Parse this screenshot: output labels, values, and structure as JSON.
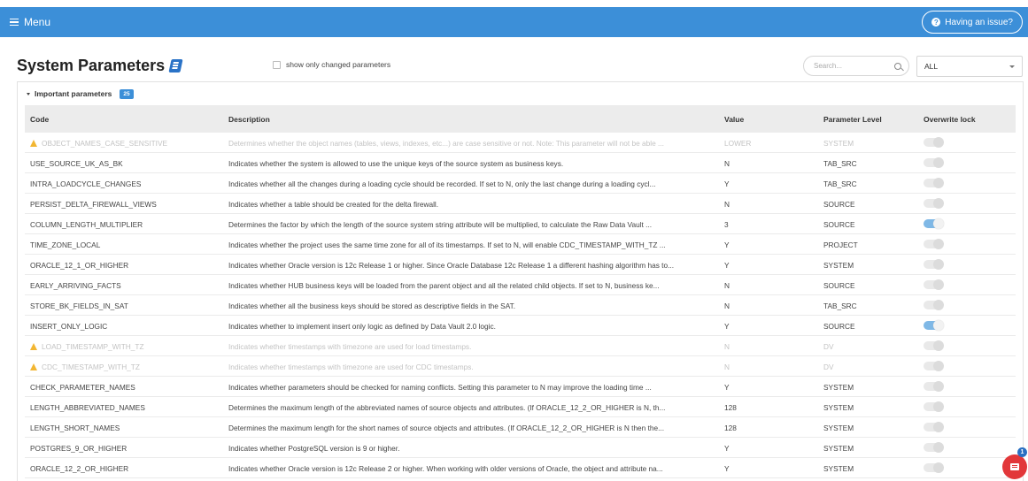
{
  "topbar": {
    "menu_label": "Menu",
    "issue_label": "Having an issue?"
  },
  "page": {
    "title": "System Parameters",
    "show_changed_label": "show only changed parameters",
    "search_placeholder": "Search...",
    "level_selected": "ALL"
  },
  "section": {
    "title": "Important parameters",
    "count": "25"
  },
  "table": {
    "headers": {
      "code": "Code",
      "description": "Description",
      "value": "Value",
      "level": "Parameter Level",
      "lock": "Overwrite lock"
    },
    "rows": [
      {
        "code": "OBJECT_NAMES_CASE_SENSITIVE",
        "description": "Determines whether the object names (tables, views, indexes, etc...) are case sensitive or not. Note: This parameter will not be able ...",
        "value": "LOWER",
        "level": "SYSTEM",
        "lock": false,
        "dim": true,
        "warn": true
      },
      {
        "code": "USE_SOURCE_UK_AS_BK",
        "description": "Indicates whether the system is allowed to use the unique keys of the source system as business keys.",
        "value": "N",
        "level": "TAB_SRC",
        "lock": false,
        "dim": false,
        "warn": false
      },
      {
        "code": "INTRA_LOADCYCLE_CHANGES",
        "description": "Indicates whether all the changes during a loading cycle should be recorded. If set to N, only the last change during a loading cycl...",
        "value": "Y",
        "level": "TAB_SRC",
        "lock": false,
        "dim": false,
        "warn": false
      },
      {
        "code": "PERSIST_DELTA_FIREWALL_VIEWS",
        "description": "Indicates whether a table should be created for the delta firewall.",
        "value": "N",
        "level": "SOURCE",
        "lock": false,
        "dim": false,
        "warn": false
      },
      {
        "code": "COLUMN_LENGTH_MULTIPLIER",
        "description": "Determines the factor by which the length of the source system string attribute will be multiplied, to calculate the Raw Data Vault ...",
        "value": "3",
        "level": "SOURCE",
        "lock": true,
        "dim": false,
        "warn": false
      },
      {
        "code": "TIME_ZONE_LOCAL",
        "description": "Indicates whether the project uses the same time zone for all of its timestamps. If set to N, will enable CDC_TIMESTAMP_WITH_TZ ...",
        "value": "Y",
        "level": "PROJECT",
        "lock": false,
        "dim": false,
        "warn": false
      },
      {
        "code": "ORACLE_12_1_OR_HIGHER",
        "description": "Indicates whether Oracle version is 12c Release 1 or higher. Since Oracle Database 12c Release 1 a different hashing algorithm has to...",
        "value": "Y",
        "level": "SYSTEM",
        "lock": false,
        "dim": false,
        "warn": false
      },
      {
        "code": "EARLY_ARRIVING_FACTS",
        "description": "Indicates whether HUB business keys will be loaded from the parent object and all the related child objects. If set to N, business ke...",
        "value": "N",
        "level": "SOURCE",
        "lock": false,
        "dim": false,
        "warn": false
      },
      {
        "code": "STORE_BK_FIELDS_IN_SAT",
        "description": "Indicates whether all the business keys should be stored as descriptive fields in the SAT.",
        "value": "N",
        "level": "TAB_SRC",
        "lock": false,
        "dim": false,
        "warn": false
      },
      {
        "code": "INSERT_ONLY_LOGIC",
        "description": "Indicates whether to implement insert only logic as defined by Data Vault 2.0 logic.",
        "value": "Y",
        "level": "SOURCE",
        "lock": true,
        "dim": false,
        "warn": false
      },
      {
        "code": "LOAD_TIMESTAMP_WITH_TZ",
        "description": "Indicates whether timestamps with timezone are used for load timestamps.",
        "value": "N",
        "level": "DV",
        "lock": false,
        "dim": true,
        "warn": true
      },
      {
        "code": "CDC_TIMESTAMP_WITH_TZ",
        "description": "Indicates whether timestamps with timezone are used for CDC timestamps.",
        "value": "N",
        "level": "DV",
        "lock": false,
        "dim": true,
        "warn": true
      },
      {
        "code": "CHECK_PARAMETER_NAMES",
        "description": "Indicates whether parameters should be checked for naming conflicts. Setting this parameter to N may improve the loading time ...",
        "value": "Y",
        "level": "SYSTEM",
        "lock": false,
        "dim": false,
        "warn": false
      },
      {
        "code": "LENGTH_ABBREVIATED_NAMES",
        "description": "Determines the maximum length of the abbreviated names of source objects and attributes. (If ORACLE_12_2_OR_HIGHER is N, th...",
        "value": "128",
        "level": "SYSTEM",
        "lock": false,
        "dim": false,
        "warn": false
      },
      {
        "code": "LENGTH_SHORT_NAMES",
        "description": "Determines the maximum length for the short names of source objects and attributes. (If ORACLE_12_2_OR_HIGHER is N then the...",
        "value": "128",
        "level": "SYSTEM",
        "lock": false,
        "dim": false,
        "warn": false
      },
      {
        "code": "POSTGRES_9_OR_HIGHER",
        "description": "Indicates whether PostgreSQL version is 9 or higher.",
        "value": "Y",
        "level": "SYSTEM",
        "lock": false,
        "dim": false,
        "warn": false
      },
      {
        "code": "ORACLE_12_2_OR_HIGHER",
        "description": "Indicates whether Oracle version is 12c Release 2 or higher. When working with older versions of Oracle, the object and attribute na...",
        "value": "Y",
        "level": "SYSTEM",
        "lock": false,
        "dim": false,
        "warn": false
      }
    ]
  },
  "chat": {
    "notification_count": "1"
  }
}
